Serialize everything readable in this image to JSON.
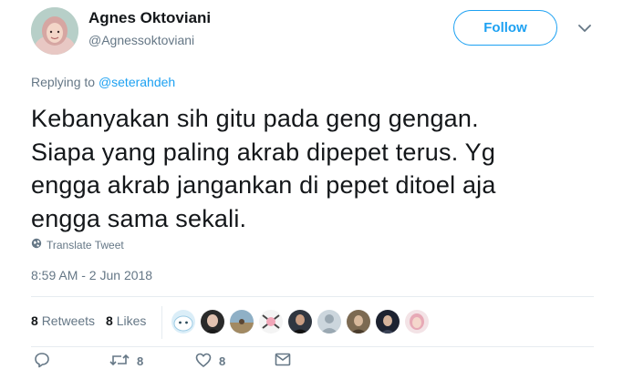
{
  "author": {
    "name": "Agnes Oktoviani",
    "handle": "@Agnessoktoviani"
  },
  "follow_label": "Follow",
  "replying_prefix": "Replying to",
  "replying_to": "@seterahdeh",
  "tweet_lines": [
    "Kebanyakan sih gitu pada geng gengan.",
    "Siapa yang paling akrab dipepet terus. Yg",
    "engga akrab jangankan di pepet ditoel aja",
    "engga sama sekali."
  ],
  "translate_label": "Translate Tweet",
  "timestamp": "8:59 AM - 2 Jun 2018",
  "stats": {
    "retweets_count": "8",
    "retweets_label": "Retweets",
    "likes_count": "8",
    "likes_label": "Likes"
  },
  "actions": {
    "retweet_count": "8",
    "like_count": "8"
  },
  "colors": {
    "accent": "#1da1f2",
    "muted": "#657786",
    "text": "#14171a",
    "divider": "#e6ecf0"
  }
}
